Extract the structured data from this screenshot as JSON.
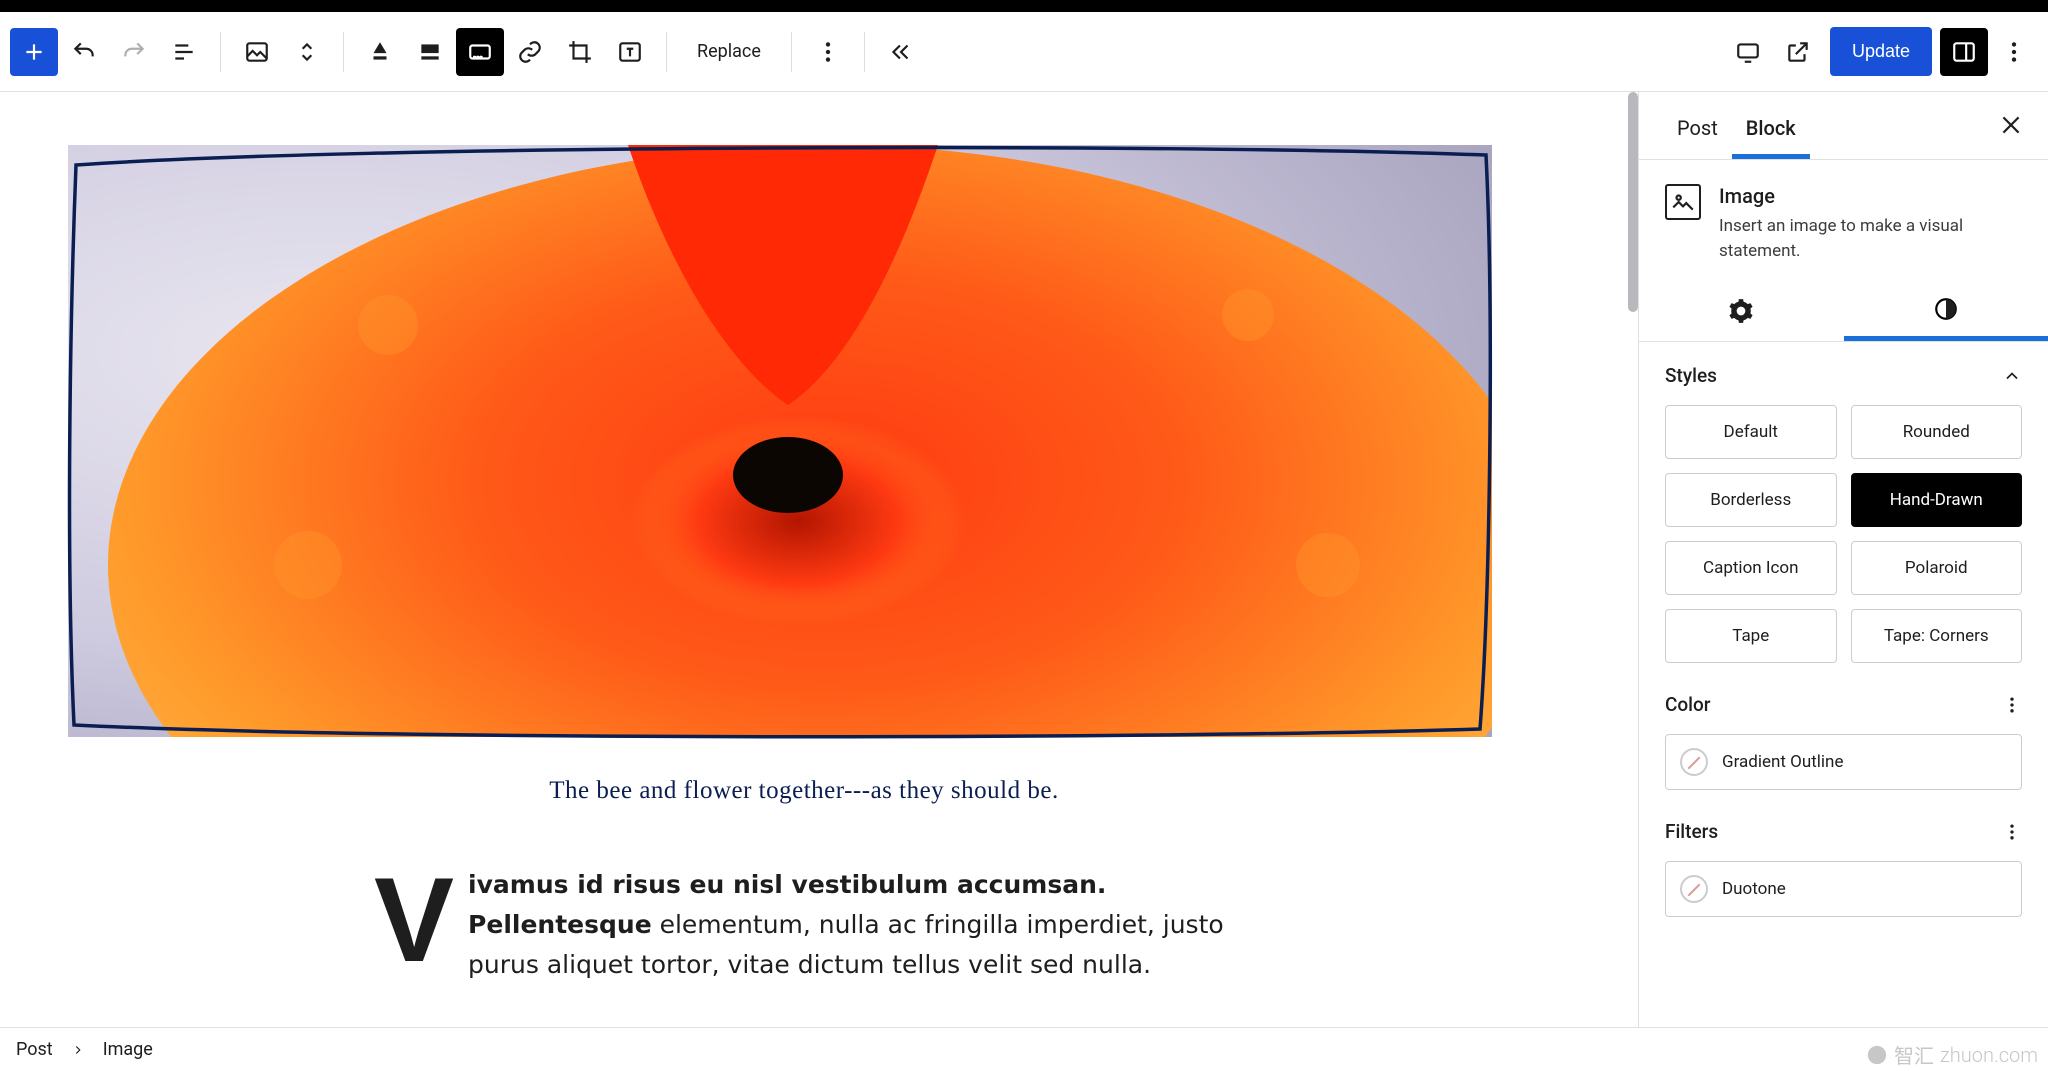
{
  "toolbar": {
    "replace": "Replace",
    "update": "Update"
  },
  "sidebar": {
    "tabs": {
      "post": "Post",
      "block": "Block"
    },
    "block_name": "Image",
    "block_desc": "Insert an image to make a visual statement.",
    "styles_label": "Styles",
    "styles": [
      "Default",
      "Rounded",
      "Borderless",
      "Hand-Drawn",
      "Caption Icon",
      "Polaroid",
      "Tape",
      "Tape: Corners"
    ],
    "styles_active": 3,
    "color_label": "Color",
    "gradient_outline": "Gradient Outline",
    "filters_label": "Filters",
    "duotone": "Duotone"
  },
  "content": {
    "caption": "The bee and flower together---as they should be.",
    "drop": "V",
    "body_lead": "ivamus id risus eu nisl vestibulum accumsan. Pellentesque",
    "body_rest": " elementum, nulla ac fringilla imperdiet, justo purus aliquet tortor, vitae dictum tellus velit sed nulla."
  },
  "breadcrumb": {
    "root": "Post",
    "leaf": "Image"
  },
  "watermark": {
    "zh": "智汇",
    "dom": "zhuon.com"
  }
}
